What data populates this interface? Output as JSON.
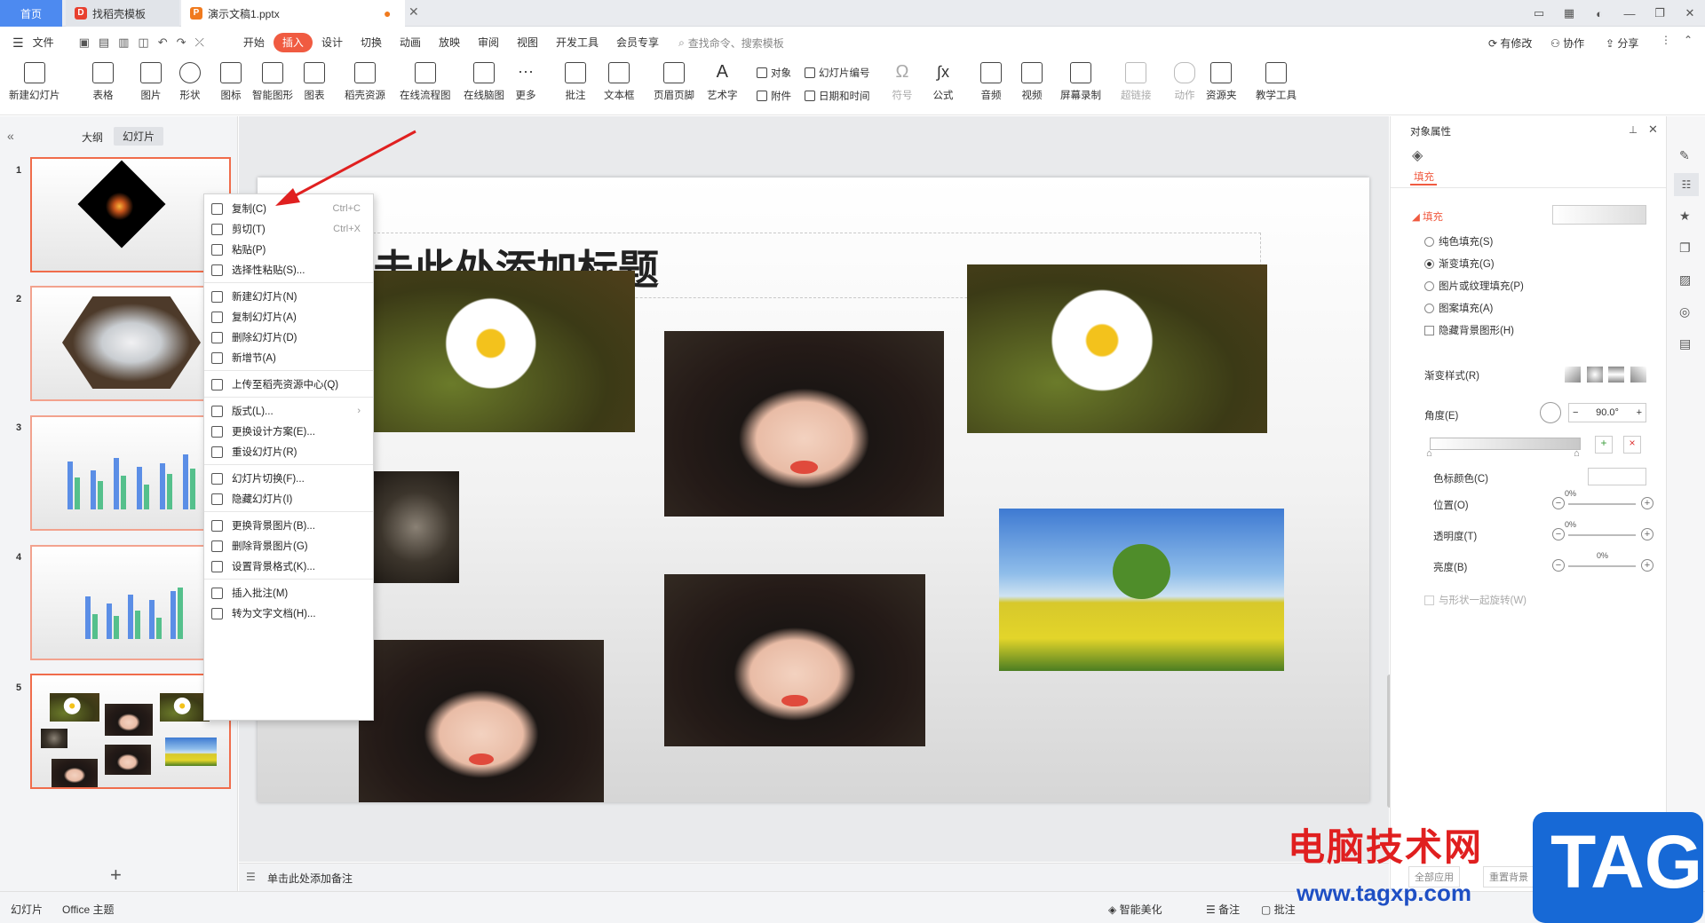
{
  "tabs": {
    "home": "首页",
    "template": "找稻壳模板",
    "doc": "演示文稿1.pptx"
  },
  "menus": [
    "文件",
    "开始",
    "插入",
    "设计",
    "切换",
    "动画",
    "放映",
    "审阅",
    "视图",
    "开发工具",
    "会员专享"
  ],
  "menu_active": "插入",
  "search_placeholder": "查找命令、搜索模板",
  "top_right": {
    "modified": "有修改",
    "collab": "协作",
    "share": "分享"
  },
  "toolbar": [
    "新建幻灯片",
    "表格",
    "图片",
    "形状",
    "图标",
    "智能图形",
    "图表",
    "稻壳资源",
    "在线流程图",
    "在线脑图",
    "更多",
    "批注",
    "文本框",
    "页眉页脚",
    "艺术字",
    "符号",
    "公式",
    "音频",
    "视频",
    "屏幕录制",
    "超链接",
    "动作",
    "资源夹",
    "教学工具"
  ],
  "toolbar_small": {
    "object": "对象",
    "slide_num": "幻灯片编号",
    "attach": "附件",
    "datetime": "日期和时间"
  },
  "left_tabs": {
    "outline": "大纲",
    "slides": "幻灯片"
  },
  "slide_numbers": [
    "1",
    "2",
    "3",
    "4",
    "5"
  ],
  "slide_title_placeholder": "击此处添加标题",
  "notes_placeholder": "单击此处添加备注",
  "context_menu": [
    {
      "label": "复制(C)",
      "shortcut": "Ctrl+C"
    },
    {
      "label": "剪切(T)",
      "shortcut": "Ctrl+X"
    },
    {
      "label": "粘贴(P)",
      "shortcut": ""
    },
    {
      "label": "选择性粘贴(S)...",
      "shortcut": ""
    },
    {
      "label": "新建幻灯片(N)",
      "shortcut": ""
    },
    {
      "label": "复制幻灯片(A)",
      "shortcut": ""
    },
    {
      "label": "删除幻灯片(D)",
      "shortcut": ""
    },
    {
      "label": "新增节(A)",
      "shortcut": ""
    },
    {
      "label": "上传至稻壳资源中心(Q)",
      "shortcut": ""
    },
    {
      "label": "版式(L)...",
      "shortcut": ""
    },
    {
      "label": "更换设计方案(E)...",
      "shortcut": ""
    },
    {
      "label": "重设幻灯片(R)",
      "shortcut": ""
    },
    {
      "label": "幻灯片切换(F)...",
      "shortcut": ""
    },
    {
      "label": "隐藏幻灯片(I)",
      "shortcut": ""
    },
    {
      "label": "更换背景图片(B)...",
      "shortcut": ""
    },
    {
      "label": "删除背景图片(G)",
      "shortcut": ""
    },
    {
      "label": "设置背景格式(K)...",
      "shortcut": ""
    },
    {
      "label": "插入批注(M)",
      "shortcut": ""
    },
    {
      "label": "转为文字文档(H)...",
      "shortcut": ""
    }
  ],
  "panel": {
    "title": "对象属性",
    "tab_fill": "填充",
    "section": "填充",
    "options": [
      "纯色填充(S)",
      "渐变填充(G)",
      "图片或纹理填充(P)",
      "图案填充(A)"
    ],
    "selected_option": "渐变填充(G)",
    "hide_bg": "隐藏背景图形(H)",
    "gradient_style": "渐变样式(R)",
    "angle_label": "角度(E)",
    "angle_value": "90.0°",
    "stop_color": "色标颜色(C)",
    "position": "位置(O)",
    "position_value": "0%",
    "transparency": "透明度(T)",
    "transparency_value": "0%",
    "brightness": "亮度(B)",
    "brightness_value": "0%",
    "rotate": "与形状一起旋转(W)",
    "apply_all": "全部应用",
    "reset_bg": "重置背景"
  },
  "status": {
    "slide": "幻灯片",
    "theme": "Office 主题",
    "beautify": "智能美化",
    "notes": "备注",
    "comment": "批注"
  },
  "watermark": {
    "text": "电脑技术网",
    "url": "www.tagxp.com",
    "tag": "TAG"
  },
  "colors": {
    "accent": "#f05b41",
    "home_tab": "#4d8af0"
  }
}
